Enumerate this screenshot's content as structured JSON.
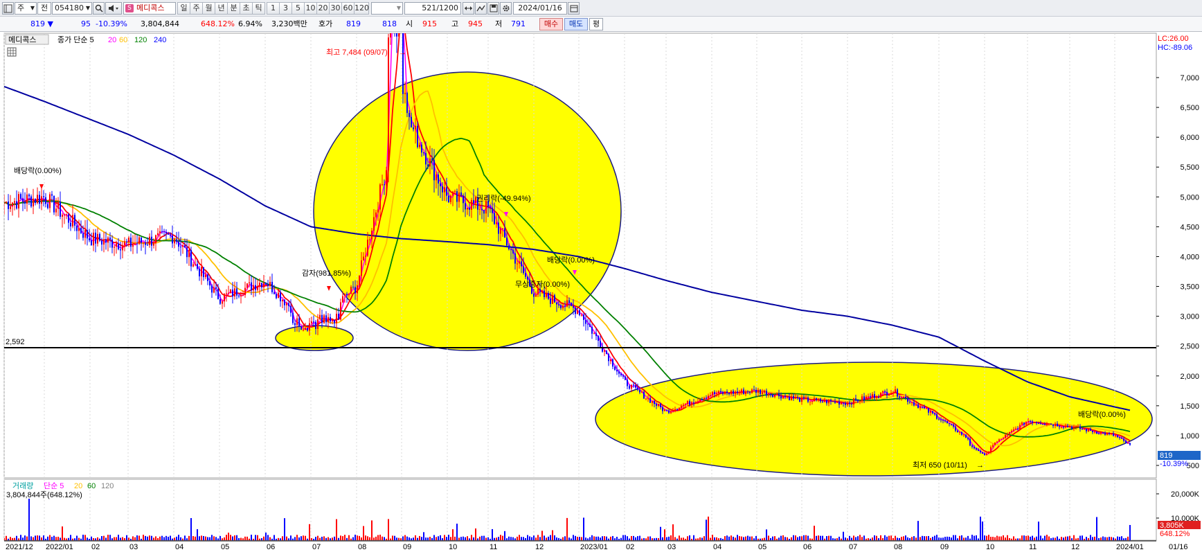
{
  "toolbar": {
    "market": "주",
    "type": "전",
    "code": "054180",
    "stock_name": "메디콕스",
    "periods": [
      "일",
      "주",
      "월",
      "년",
      "분",
      "초",
      "틱"
    ],
    "active_period": "일",
    "numbers": [
      "1",
      "3",
      "5",
      "10",
      "20",
      "30",
      "60",
      "120"
    ],
    "count": "521",
    "count_max": "/1200",
    "date": "2024/01/16"
  },
  "quote": {
    "price": "819",
    "direction": "▼",
    "change": "95",
    "change_pct": "-10.39%",
    "volume": "3,804,844",
    "volume_pct": "648.12%",
    "turnover": "6.94%",
    "amount": "3,230백만",
    "hoga_label": "호가",
    "ask": "819",
    "bid": "818",
    "open_label": "시",
    "open": "915",
    "high_label": "고",
    "high": "945",
    "low_label": "저",
    "low": "791",
    "buy_label": "매수",
    "sell_label": "매도",
    "avg_label": "평"
  },
  "price_panel": {
    "legend_name": "메디콕스",
    "legend_type": "종가 단순 5",
    "legend_periods": [
      "20",
      "60",
      "120",
      "240"
    ],
    "lc": "LC:26.00",
    "hc": "HC:-89.06",
    "current_price": "819",
    "current_pct": "-10.39%",
    "hline_label": "2,592",
    "hline_value": 2592
  },
  "volume_panel": {
    "legend_name": "거래량",
    "legend_type": "단순 5",
    "legend_periods": [
      "20",
      "60",
      "120"
    ],
    "volume_text": "3,804,844주(648.12%)",
    "current_volume": "3,805K",
    "current_pct": "648.12%"
  },
  "annotations": {
    "high": "최고 7,484 (09/07)",
    "low": "최저 650 (10/11)",
    "dividend1": "배당락(0.00%)",
    "dividend2": "배당락(0.00%)",
    "dividend3": "배당락(0.00%)",
    "reduction": "감자(981.85%)",
    "rights": "권리락(-49.94%)",
    "bonus": "무상증자(0.00%)"
  },
  "colors": {
    "up": "#ff0000",
    "down": "#0000ff",
    "ma5": "#ff00ff",
    "ma20": "#ff0000",
    "ma60": "#ffc000",
    "ma120": "#008000",
    "ma240": "#0000a0",
    "highlight": "#ffff00"
  },
  "chart_data": {
    "type": "line",
    "price_ticks": [
      "7,000",
      "6,500",
      "6,000",
      "5,500",
      "5,000",
      "4,500",
      "4,000",
      "3,500",
      "3,000",
      "2,500",
      "2,000",
      "1,500",
      "1,000",
      "500"
    ],
    "volume_ticks": [
      "20,000K",
      "10,000K"
    ],
    "x_labels": [
      "2021/12",
      "2022/01",
      "02",
      "03",
      "04",
      "05",
      "06",
      "07",
      "08",
      "09",
      "10",
      "11",
      "12",
      "2023/01",
      "02",
      "03",
      "04",
      "05",
      "06",
      "07",
      "08",
      "09",
      "10",
      "11",
      "12",
      "2024/01",
      "01/16"
    ],
    "series": [
      {
        "name": "종가",
        "x": [
          "2021/12",
          "2022/01",
          "02",
          "03",
          "04",
          "05",
          "06",
          "07",
          "08",
          "09",
          "10",
          "11",
          "12",
          "2023/01",
          "02",
          "03",
          "04",
          "05",
          "06",
          "07",
          "08",
          "09",
          "10",
          "11",
          "12",
          "2024/01",
          "01/16"
        ],
        "values": [
          4900,
          5000,
          4300,
          4200,
          4350,
          3300,
          3600,
          2800,
          3500,
          6500,
          5000,
          4800,
          3400,
          3100,
          1900,
          1400,
          1700,
          1750,
          1600,
          1550,
          1750,
          1300,
          750,
          1250,
          1150,
          1000,
          819
        ]
      },
      {
        "name": "240",
        "x": [
          "2021/12",
          "2022/01",
          "02",
          "03",
          "04",
          "05",
          "06",
          "07",
          "08",
          "09",
          "10",
          "11",
          "12",
          "2023/01",
          "02",
          "03",
          "04",
          "05",
          "06",
          "07",
          "08",
          "09",
          "10",
          "11",
          "12",
          "2024/01",
          "01/16"
        ],
        "values": [
          6850,
          6600,
          6300,
          6050,
          5700,
          5300,
          4850,
          4500,
          4380,
          4300,
          4250,
          4200,
          4120,
          4000,
          3800,
          3600,
          3400,
          3250,
          3100,
          3000,
          2850,
          2650,
          2250,
          1900,
          1650,
          1480,
          1420
        ]
      }
    ],
    "ylim": [
      500,
      7484
    ]
  }
}
